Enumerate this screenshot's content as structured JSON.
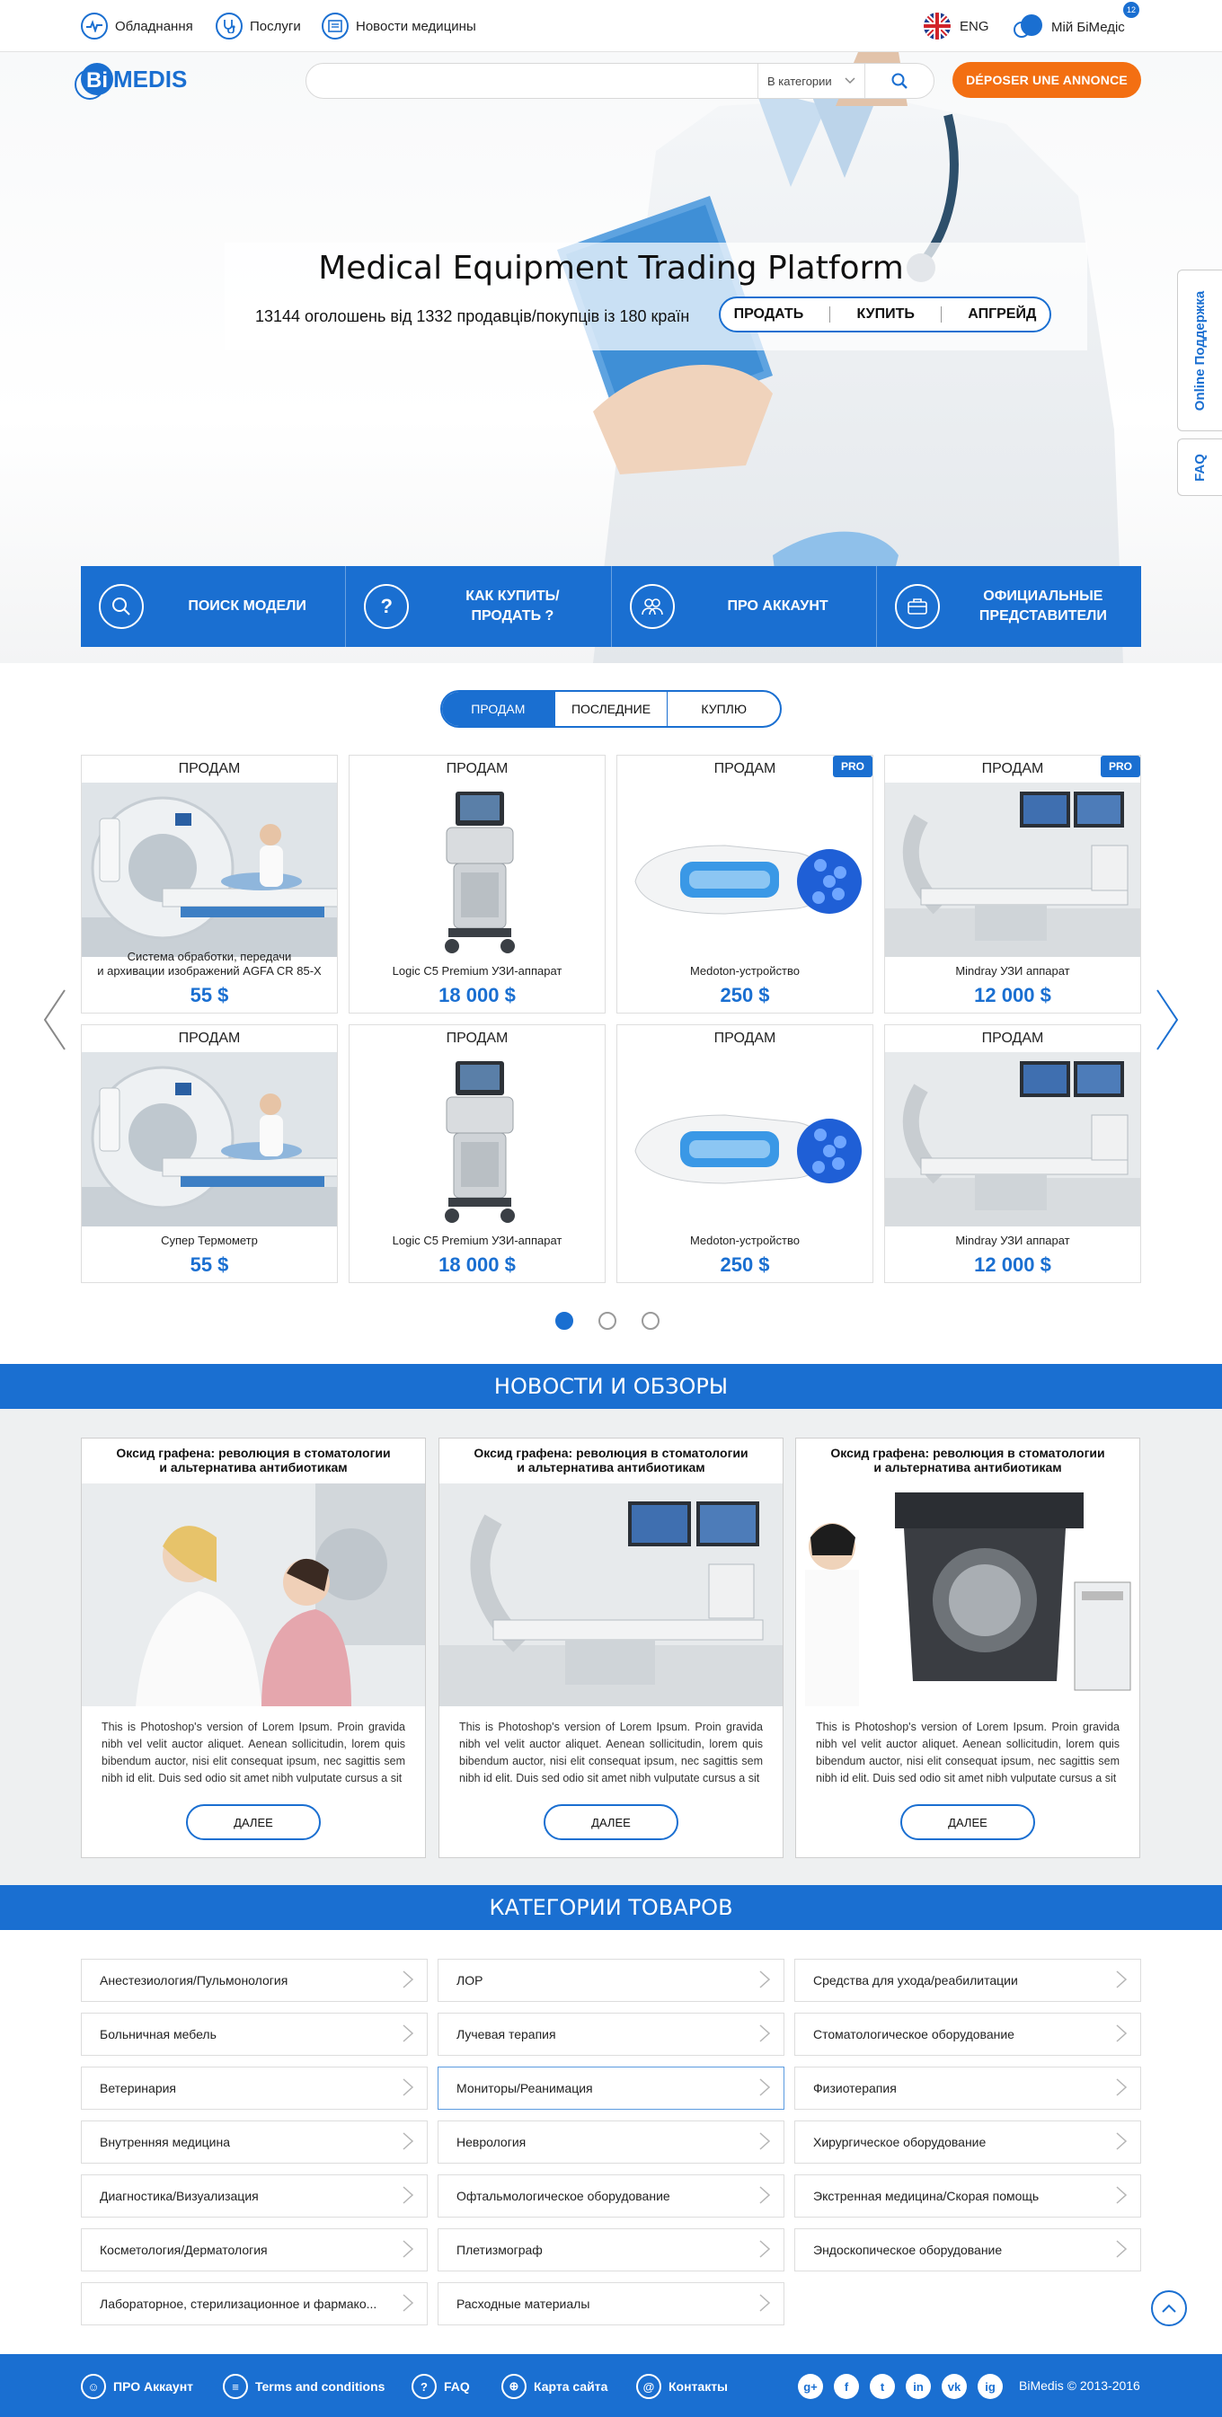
{
  "topnav": {
    "equipment": "Обладнання",
    "services": "Послуги",
    "news": "Новости медицины",
    "lang": "ENG",
    "account": "Мій БіМедіс",
    "account_badge": "12"
  },
  "header": {
    "logo": "BiMedis",
    "search_value": "",
    "category_select": "В категории",
    "post_button": "DÉPOSER UNE ANNONCE"
  },
  "hero": {
    "title": "Medical Equipment Trading Platform",
    "subtitle": "13144 оголошень від 1332 продавців/покупців із 180 країн",
    "actions": [
      "ПРОДАТЬ",
      "КУПИТЬ",
      "АПГРЕЙД"
    ]
  },
  "bluebar": {
    "items": [
      {
        "label": "ПОИСК МОДЕЛИ",
        "icon": "search-icon"
      },
      {
        "label": "КАК КУПИТЬ/ПРОДАТЬ ?",
        "icon": "question-icon"
      },
      {
        "label": "ПРО АККАУНТ",
        "icon": "users-icon"
      },
      {
        "label": "ОФИЦИАЛЬНЫЕ ПРЕДСТАВИТЕЛИ",
        "icon": "briefcase-icon"
      }
    ]
  },
  "side_tabs": {
    "support": "Online Поддержка",
    "faq": "FAQ"
  },
  "listing_tabs": [
    "ПРОДАМ",
    "ПОСЛЕДНИЕ",
    "КУПЛЮ"
  ],
  "listings": [
    {
      "label": "ПРОДАМ",
      "pro": "",
      "name": "Система обработки, передачи\nи архивации изображений AGFA CR 85-X",
      "price": "55 $",
      "img": "ct"
    },
    {
      "label": "ПРОДАМ",
      "pro": "",
      "name": "Logic C5 Premium УЗИ-аппарат",
      "price": "18 000 $",
      "img": "us"
    },
    {
      "label": "ПРОДАМ",
      "pro": "PRO",
      "name": "Medoton-устройство",
      "price": "250 $",
      "img": "med"
    },
    {
      "label": "ПРОДАМ",
      "pro": "PRO",
      "name": "Mindray УЗИ аппарат",
      "price": "12 000 $",
      "img": "angio"
    },
    {
      "label": "ПРОДАМ",
      "pro": "",
      "name": "Супер Термометр",
      "price": "55 $",
      "img": "ct"
    },
    {
      "label": "ПРОДАМ",
      "pro": "",
      "name": "Logic C5 Premium УЗИ-аппарат",
      "price": "18 000 $",
      "img": "us"
    },
    {
      "label": "ПРОДАМ",
      "pro": "",
      "name": "Medoton-устройство",
      "price": "250 $",
      "img": "med"
    },
    {
      "label": "ПРОДАМ",
      "pro": "",
      "name": "Mindray УЗИ аппарат",
      "price": "12 000 $",
      "img": "angio"
    }
  ],
  "carousel": {
    "pages": 3,
    "current": 1
  },
  "news_section": {
    "title": "НОВОСТИ И ОБЗОРЫ",
    "items": [
      {
        "title": "Оксид графена: революция в стоматологии\nи альтернатива антибиотикам",
        "text": "This is Photoshop's version  of Lorem Ipsum. Proin gravida nibh vel velit auctor aliquet. Aenean sollicitudin, lorem quis bibendum auctor, nisi elit consequat ipsum, nec sagittis sem nibh id elit. Duis sed odio sit amet nibh vulputate cursus a sit",
        "button": "ДАЛЕЕ"
      },
      {
        "title": "Оксид графена: революция в стоматологии\nи альтернатива антибиотикам",
        "text": "This is Photoshop's version  of Lorem Ipsum. Proin gravida nibh vel velit auctor aliquet. Aenean sollicitudin, lorem quis bibendum auctor, nisi elit consequat ipsum, nec sagittis sem nibh id elit. Duis sed odio sit amet nibh vulputate cursus a sit",
        "button": "ДАЛЕЕ"
      },
      {
        "title": "Оксид графена: революция в стоматологии\nи альтернатива антибиотикам",
        "text": "This is Photoshop's version  of Lorem Ipsum. Proin gravida nibh vel velit auctor aliquet. Aenean sollicitudin, lorem quis bibendum auctor, nisi elit consequat ipsum, nec sagittis sem nibh id elit. Duis sed odio sit amet nibh vulputate cursus a sit",
        "button": "ДАЛЕЕ"
      }
    ]
  },
  "categories_section": {
    "title": "КАТЕГОРИИ ТОВАРОВ",
    "items": [
      "Анестезиология/Пульмонология",
      "ЛОР",
      "Средства для ухода/реабилитации",
      "Больничная мебель",
      "Лучевая терапия",
      "Стоматологическое оборудование",
      "Ветеринария",
      "Мониторы/Реанимация",
      "Физиотерапия",
      "Внутренняя медицина",
      "Неврология",
      "Хирургическое оборудование",
      "Диагностика/Визуализация",
      "Офтальмологическое оборудование",
      "Экстренная медицина/Скорая помощь",
      "Косметология/Дерматология",
      "Плетизмограф",
      "Эндоскопическое оборудование",
      "Лабораторное, стерилизационное и фармако...",
      "Расходные материалы",
      ""
    ]
  },
  "footer": {
    "account": "ПРО Аккаунт",
    "terms": "Terms and conditions",
    "faq": "FAQ",
    "sitemap": "Карта сайта",
    "contacts": "Контакты",
    "social": [
      "g+",
      "f",
      "t",
      "in",
      "vk",
      "ig"
    ],
    "copyright": "BiMedis © 2013-2016"
  },
  "colors": {
    "accent": "#1a6fd1",
    "orange": "#f36f12"
  }
}
